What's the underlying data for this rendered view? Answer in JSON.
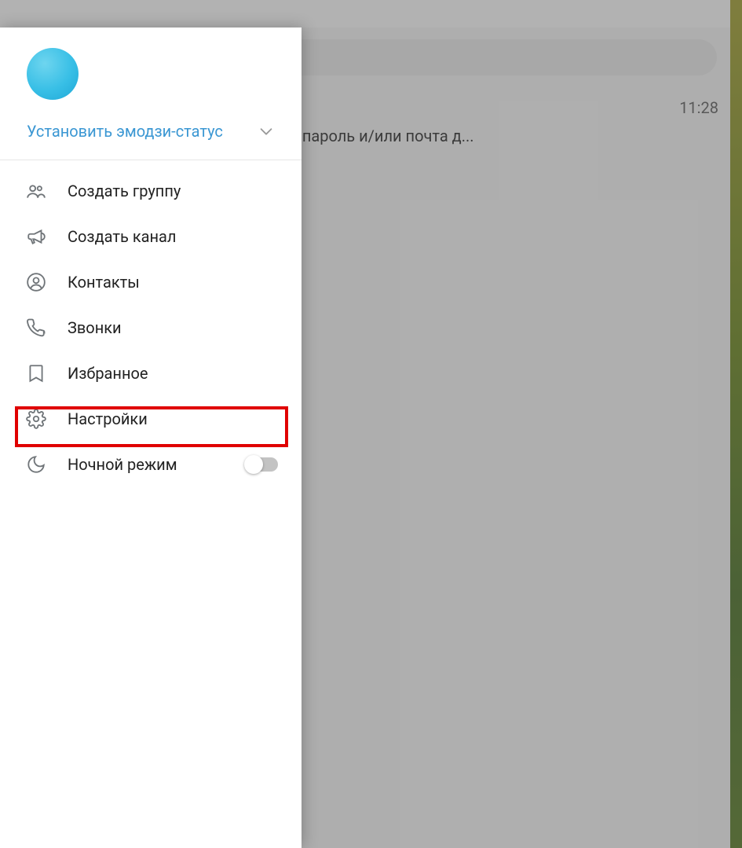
{
  "chat": {
    "time": "11:28",
    "snippet": "й аутентификации. Уважаемый(ая) ., пароль и/или почта д..."
  },
  "drawer": {
    "set_status_label": "Установить эмодзи-статус",
    "menu": {
      "new_group": "Создать группу",
      "new_channel": "Создать канал",
      "contacts": "Контакты",
      "calls": "Звонки",
      "saved": "Избранное",
      "settings": "Настройки",
      "night_mode": "Ночной режим"
    },
    "night_mode_on": false
  }
}
